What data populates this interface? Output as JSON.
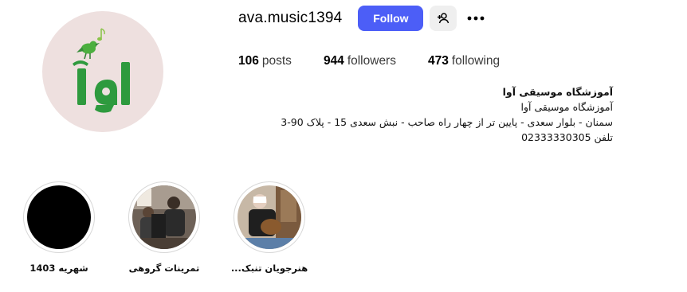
{
  "profile": {
    "username": "ava.music1394",
    "follow_label": "Follow",
    "avatar_logo_text": "آوا",
    "stats": {
      "posts_count": "106",
      "posts_label": "posts",
      "followers_count": "944",
      "followers_label": "followers",
      "following_count": "473",
      "following_label": "following"
    },
    "bio": {
      "name": "آموزشگاه موسیقی آوا",
      "category": "آموزشگاه موسیقی آوا",
      "address": "سمنان - بلوار سعدی - پایین تر از چهار راه صاحب - نبش سعدی 15 - پلاک 90-3",
      "phone": "تلفن 02333330305"
    }
  },
  "highlights": [
    {
      "label": "شهریه 1403",
      "cover": "black"
    },
    {
      "label": "تمرینات گروهی",
      "cover": "photo-group"
    },
    {
      "label": "هنرجویان تنبک...",
      "cover": "photo-tombak"
    }
  ],
  "colors": {
    "follow_button": "#4c5ef7",
    "logo_green": "#2e9a3e",
    "avatar_bg": "#eee0df"
  },
  "icons": {
    "add_user": "person-plus-icon",
    "more": "more-horizontal-icon"
  }
}
